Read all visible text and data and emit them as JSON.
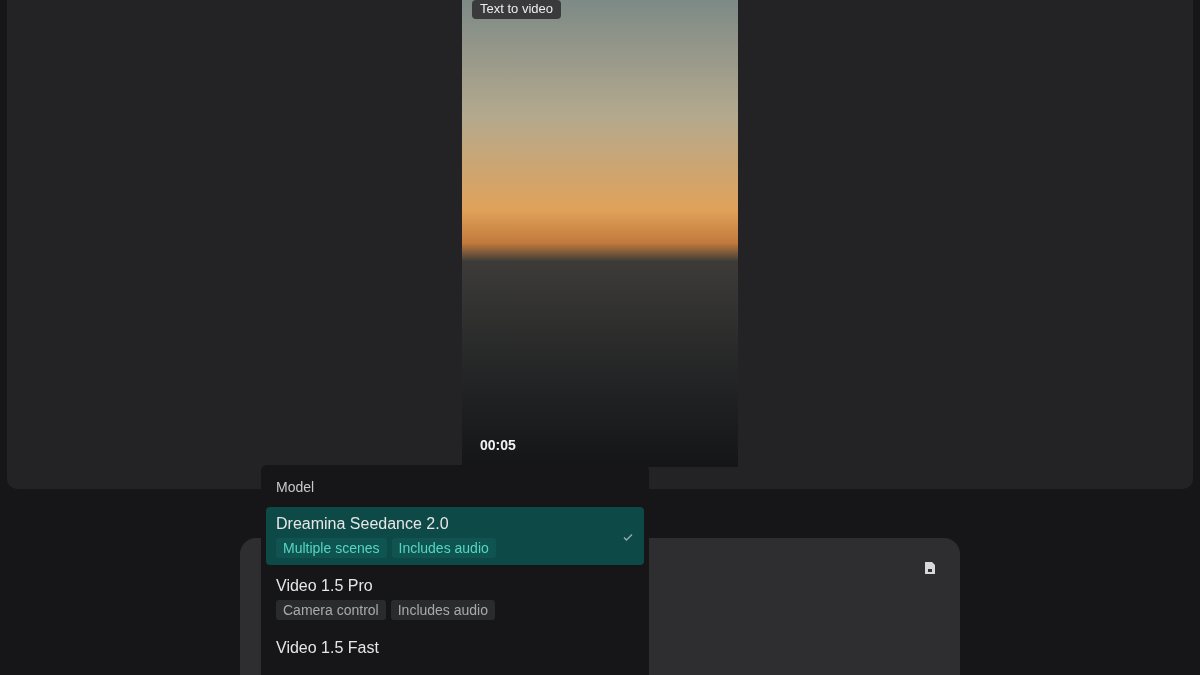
{
  "preview": {
    "badge": "Text to video",
    "duration": "00:05"
  },
  "model_menu": {
    "title": "Model",
    "items": [
      {
        "name": "Dreamina Seedance 2.0",
        "selected": true,
        "tags": [
          "Multiple scenes",
          "Includes audio"
        ]
      },
      {
        "name": "Video 1.5 Pro",
        "selected": false,
        "tags": [
          "Camera control",
          "Includes audio"
        ]
      },
      {
        "name": "Video 1.5 Fast",
        "selected": false
      }
    ]
  }
}
